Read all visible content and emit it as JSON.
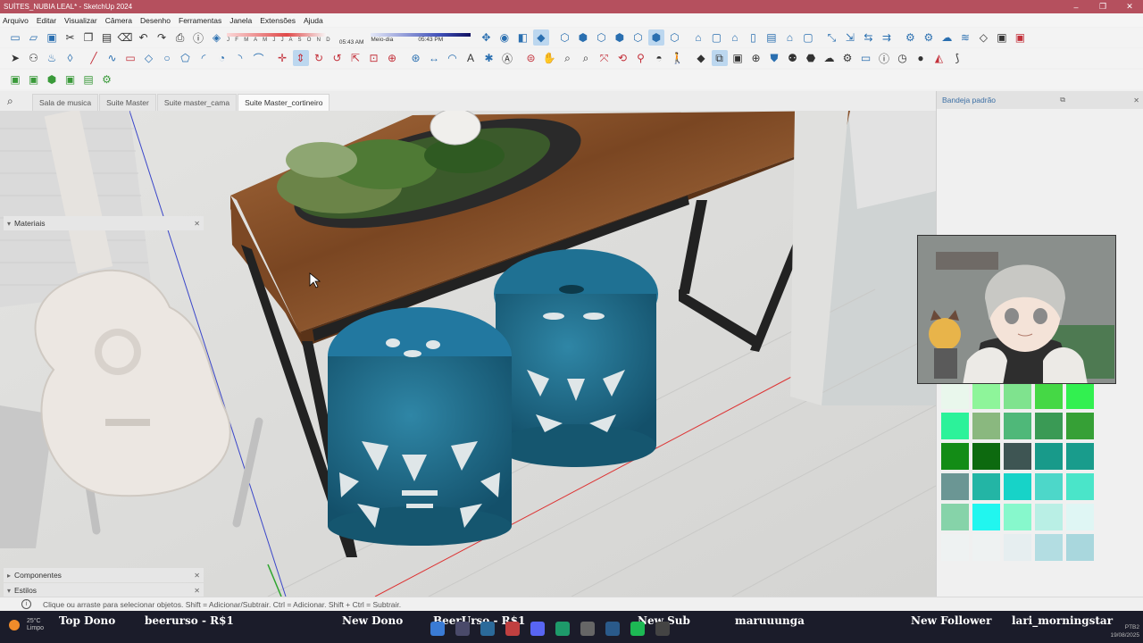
{
  "window": {
    "title": "SUÍTES_NUBIA LEAL* - SketchUp 2024",
    "minimize": "–",
    "maximize": "❐",
    "close": "✕"
  },
  "menu": [
    "Arquivo",
    "Editar",
    "Visualizar",
    "Câmera",
    "Desenho",
    "Ferramentas",
    "Janela",
    "Extensões",
    "Ajuda"
  ],
  "shadows": {
    "months": "J F M A M J J A S O N D",
    "time_start": "05:43 AM",
    "time_mid": "Meio-dia",
    "time_end": "05:43 PM"
  },
  "scene_tabs": [
    "Sala de musica",
    "Suite Master",
    "Suite master_cama",
    "Suite Master_cortineiro"
  ],
  "active_tab": "Suite Master_cortineiro",
  "tray": {
    "title": "Bandeja padrão",
    "materials_label": "Materiais",
    "components_label": "Componentes",
    "styles_label": "Estilos"
  },
  "swatch_colors": [
    "#e9f7ec",
    "#8ef59a",
    "#7fe38e",
    "#45d845",
    "#32f050",
    "#2cf29a",
    "#8ab87f",
    "#4fb879",
    "#3a9a55",
    "#36a036",
    "#138c16",
    "#0d6a0f",
    "#3e5553",
    "#189a8a",
    "#199c8c",
    "#6b9694",
    "#23b5a5",
    "#17d3c8",
    "#4dd7c9",
    "#4ae5c9",
    "#86d3a9",
    "#21f6ef",
    "#87f8cc",
    "#b9efe5",
    "#dff6f4",
    "#eef2f2",
    "#eef2f2",
    "#e6eef0",
    "#b3dde2",
    "#a9d7dd"
  ],
  "status": {
    "message": "Clique ou arraste para selecionar objetos. Shift = Adicionar/Subtrair. Ctrl = Adicionar. Shift + Ctrl = Subtrair."
  },
  "taskbar": {
    "weather_temp": "25°C",
    "weather_desc": "Limpo",
    "ticker": [
      {
        "label": "Top Dono",
        "value": "beerurso - R$1"
      },
      {
        "label": "New Dono",
        "value": "BeerUrso - R$1"
      },
      {
        "label": "New Sub",
        "value": "maruuunga"
      },
      {
        "label": "New Follower",
        "value": "lari_morningstar"
      }
    ],
    "lang": "PTB2",
    "date": "19/08/2025"
  }
}
